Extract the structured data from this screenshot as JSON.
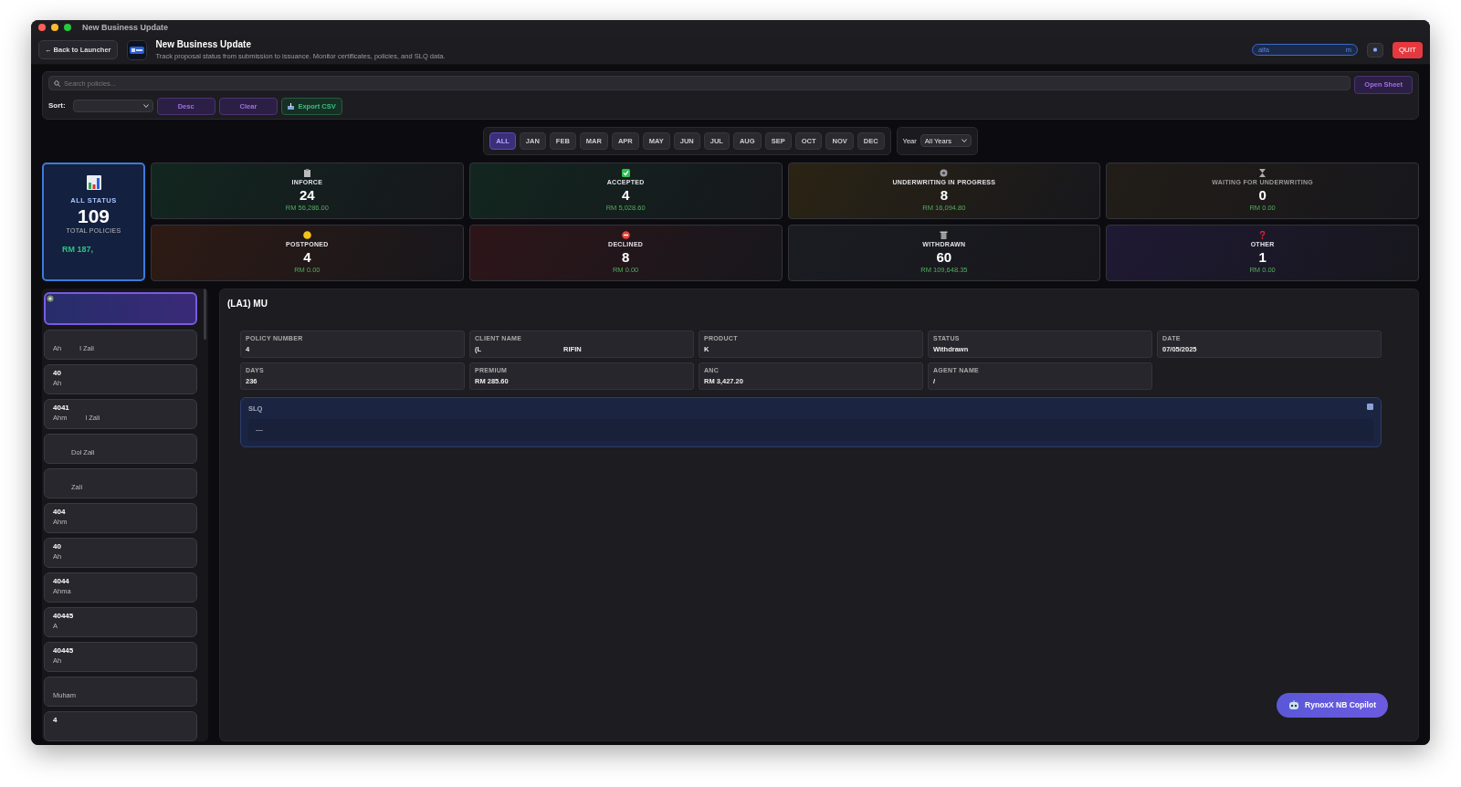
{
  "window": {
    "title": "New Business Update"
  },
  "header": {
    "back_button": "← Back to Launcher",
    "title": "New Business Update",
    "subtitle": "Track proposal status from submission to issuance. Monitor certificates, policies, and SLQ data.",
    "account": "alfa",
    "account_end": "m",
    "quit_button": "QUIT"
  },
  "toolbar": {
    "search": {
      "placeholder": "Search policies..."
    },
    "open_sheet_button": "Open Sheet",
    "sort_label": "Sort:",
    "desc_button": "Desc",
    "clear_button": "Clear",
    "export_button": "Export CSV"
  },
  "months": [
    {
      "label": "ALL",
      "selected": true
    },
    {
      "label": "JAN",
      "selected": false
    },
    {
      "label": "FEB",
      "selected": false
    },
    {
      "label": "MAR",
      "selected": false
    },
    {
      "label": "APR",
      "selected": false
    },
    {
      "label": "MAY",
      "selected": false
    },
    {
      "label": "JUN",
      "selected": false
    },
    {
      "label": "JUL",
      "selected": false
    },
    {
      "label": "AUG",
      "selected": false
    },
    {
      "label": "SEP",
      "selected": false
    },
    {
      "label": "OCT",
      "selected": false
    },
    {
      "label": "NOV",
      "selected": false
    },
    {
      "label": "DEC",
      "selected": false
    }
  ],
  "year": {
    "label": "Year",
    "value": "All Years"
  },
  "summary": {
    "label": "ALL STATUS",
    "count": "109",
    "caption": "TOTAL POLICIES",
    "amount": "RM 187,"
  },
  "stats": [
    {
      "kind": "inforce",
      "label": "INFORCE",
      "count": "24",
      "amount": "RM 56,286.00",
      "color": "#12261f"
    },
    {
      "kind": "accepted",
      "label": "ACCEPTED",
      "count": "4",
      "amount": "RM 5,028.60",
      "color": "#12261f"
    },
    {
      "kind": "underwriting",
      "label": "UNDERWRITING IN PROGRESS",
      "count": "8",
      "amount": "RM 16,094.80",
      "color": "#2b2414"
    },
    {
      "kind": "waiting",
      "label": "WAITING FOR UNDERWRITING",
      "count": "0",
      "amount": "RM 0.00",
      "color": "#221d17"
    },
    {
      "kind": "postponed",
      "label": "POSTPONED",
      "count": "4",
      "amount": "RM 0.00",
      "color": "#2e1a14"
    },
    {
      "kind": "declined",
      "label": "DECLINED",
      "count": "8",
      "amount": "RM 0.00",
      "color": "#2d1519"
    },
    {
      "kind": "withdrawn",
      "label": "WITHDRAWN",
      "count": "60",
      "amount": "RM 109,648.35",
      "color": "#1b1c22"
    },
    {
      "kind": "other",
      "label": "OTHER",
      "count": "1",
      "amount": "RM 0.00",
      "color": "#1f1934"
    }
  ],
  "policies": [
    {
      "selected": true
    },
    {
      "selected": false,
      "name": "Ah",
      "name_end": "l Zali"
    },
    {
      "selected": false,
      "number": "40",
      "name": "Ah"
    },
    {
      "selected": false,
      "number": "4041",
      "name": "Ahm",
      "name_end": "l Zali"
    },
    {
      "selected": false,
      "name_end": "Dol Zali"
    },
    {
      "selected": false,
      "name_end": "Zali"
    },
    {
      "selected": false,
      "number": "404",
      "name": "Ahm"
    },
    {
      "selected": false,
      "number": "40",
      "name": "Ah"
    },
    {
      "selected": false,
      "number": "4044",
      "name": "Ahma"
    },
    {
      "selected": false,
      "number": "40445",
      "name": "A"
    },
    {
      "selected": false,
      "number": "40445",
      "name": "Ah"
    },
    {
      "selected": false,
      "name": "Muham"
    },
    {
      "selected": false,
      "number": "4"
    }
  ],
  "detail": {
    "title": "(LA1) MU",
    "fields": [
      {
        "label": "POLICY NUMBER",
        "value": "4"
      },
      {
        "label": "CLIENT NAME",
        "value": "(L",
        "value_end": "RIFIN"
      },
      {
        "label": "PRODUCT",
        "value": "K"
      },
      {
        "label": "STATUS",
        "value": "Withdrawn"
      },
      {
        "label": "DATE",
        "value": "07/05/2025"
      },
      {
        "label": "DAYS",
        "value": "236"
      },
      {
        "label": "PREMIUM",
        "value": "RM 285.60"
      },
      {
        "label": "ANC",
        "value": "RM 3,427.20"
      },
      {
        "label": "AGENT NAME",
        "value": "/"
      }
    ],
    "slq": {
      "label": "SLQ",
      "value": "—"
    }
  },
  "copilot_button": "RynoxX NB Copilot"
}
